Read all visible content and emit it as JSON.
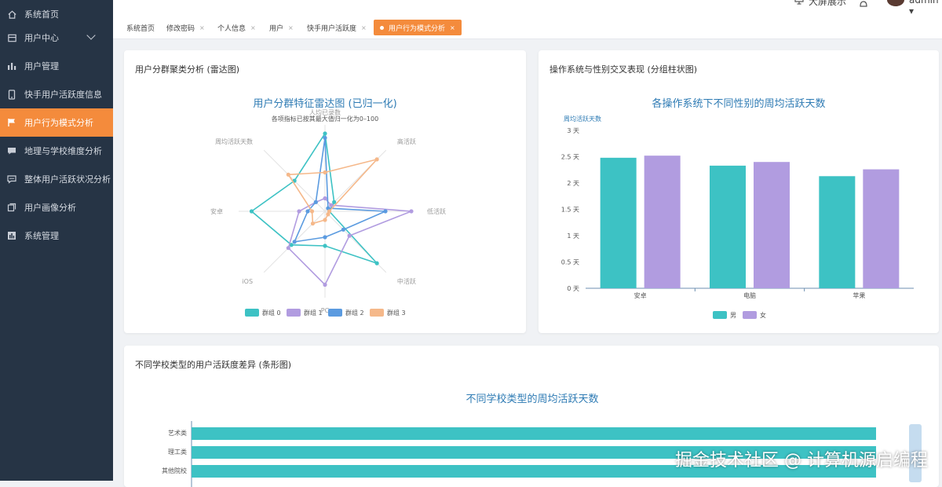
{
  "sidebar": {
    "items": [
      {
        "label": "系统首页",
        "icon": "home-icon"
      },
      {
        "label": "用户中心",
        "icon": "user-center-icon"
      },
      {
        "label": "用户管理",
        "icon": "bar-chart-icon"
      },
      {
        "label": "快手用户活跃度信息",
        "icon": "phone-icon"
      },
      {
        "label": "用户行为模式分析",
        "icon": "flag-icon"
      },
      {
        "label": "地理与学校维度分析",
        "icon": "chat-icon"
      },
      {
        "label": "整体用户活跃状况分析",
        "icon": "chat-dots-icon"
      },
      {
        "label": "用户画像分析",
        "icon": "copy-icon"
      },
      {
        "label": "系统管理",
        "icon": "chart-box-icon"
      }
    ]
  },
  "header": {
    "big_screen": "大屏展示",
    "user": "admin"
  },
  "tabs": [
    {
      "label": "系统首页"
    },
    {
      "label": "修改密码"
    },
    {
      "label": "个人信息"
    },
    {
      "label": "用户"
    },
    {
      "label": "快手用户活跃度"
    },
    {
      "label": "用户行为模式分析",
      "active": true
    }
  ],
  "cards": {
    "radar": {
      "title": "用户分群聚类分析 (雷达图)"
    },
    "bar": {
      "title": "操作系统与性别交叉表现 (分组柱状图)"
    },
    "hbar": {
      "title": "不同学校类型的用户活跃度差异 (条形图)"
    }
  },
  "watermark": "掘金技术社区 @ 计算机源启编程",
  "chart_data": [
    {
      "type": "radar",
      "title": "用户分群特征雷达图 (已归一化)",
      "subtitle": "各项指标已按其最大值归一化为0–100",
      "indicators": [
        "人均已录数",
        "高活跃",
        "低活跃",
        "中活跃",
        "PC",
        "iOS",
        "安卓",
        "周均活跃天数"
      ],
      "series": [
        {
          "name": "群组 0",
          "color": "#3dc2c4",
          "values": [
            90,
            15,
            5,
            85,
            40,
            55,
            85,
            50
          ]
        },
        {
          "name": "群组 1",
          "color": "#b19ce0",
          "values": [
            15,
            10,
            100,
            40,
            85,
            60,
            30,
            15
          ]
        },
        {
          "name": "群组 2",
          "color": "#5b9be0",
          "values": [
            85,
            5,
            70,
            30,
            30,
            50,
            20,
            15
          ]
        },
        {
          "name": "群组 3",
          "color": "#f5b88a",
          "values": [
            45,
            85,
            5,
            5,
            10,
            20,
            15,
            60
          ]
        }
      ]
    },
    {
      "type": "bar",
      "title": "各操作系统下不同性别的周均活跃天数",
      "ylabel": "周均活跃天数",
      "ylim": [
        0,
        3
      ],
      "yticks": [
        "0 天",
        "0.5 天",
        "1 天",
        "1.5 天",
        "2 天",
        "2.5 天",
        "3 天"
      ],
      "categories": [
        "安卓",
        "电脑",
        "苹果"
      ],
      "series": [
        {
          "name": "男",
          "color": "#3dc2c4",
          "values": [
            2.48,
            2.33,
            2.13
          ]
        },
        {
          "name": "女",
          "color": "#b19ce0",
          "values": [
            2.52,
            2.4,
            2.26
          ]
        }
      ]
    },
    {
      "type": "bar",
      "orientation": "horizontal",
      "title": "不同学校类型的周均活跃天数",
      "categories": [
        "艺术类",
        "理工类",
        "其他院校"
      ],
      "values": [
        2.6,
        2.6,
        2.6
      ],
      "color": "#3dc2c4"
    }
  ]
}
